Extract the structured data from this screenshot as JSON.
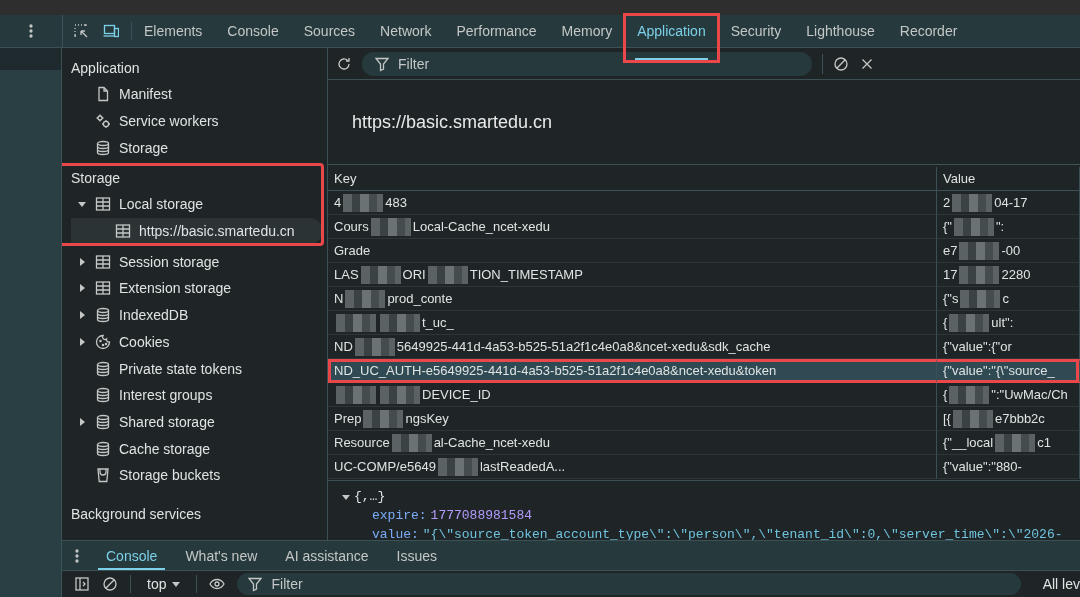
{
  "tabs": [
    {
      "label": "Elements",
      "selected": false,
      "highlighted": false
    },
    {
      "label": "Console",
      "selected": false,
      "highlighted": false
    },
    {
      "label": "Sources",
      "selected": false,
      "highlighted": false
    },
    {
      "label": "Network",
      "selected": false,
      "highlighted": false
    },
    {
      "label": "Performance",
      "selected": false,
      "highlighted": false
    },
    {
      "label": "Memory",
      "selected": false,
      "highlighted": false
    },
    {
      "label": "Application",
      "selected": true,
      "highlighted": true
    },
    {
      "label": "Security",
      "selected": false,
      "highlighted": false
    },
    {
      "label": "Lighthouse",
      "selected": false,
      "highlighted": false
    },
    {
      "label": "Recorder",
      "selected": false,
      "highlighted": false
    }
  ],
  "sidebar": {
    "sections": [
      {
        "title": "Application",
        "highlighted": false,
        "items": [
          {
            "label": "Manifest",
            "kind": "file",
            "selected": false
          },
          {
            "label": "Service workers",
            "kind": "gears",
            "selected": false
          },
          {
            "label": "Storage",
            "kind": "database",
            "selected": false
          }
        ]
      },
      {
        "title": "Storage",
        "highlighted": true,
        "items": [
          {
            "label": "Local storage",
            "kind": "table",
            "selected": false,
            "expanded": true,
            "children": [
              {
                "label": "https://basic.smartedu.cn",
                "kind": "table",
                "selected": true
              }
            ]
          }
        ]
      },
      {
        "highlighted": false,
        "items": [
          {
            "label": "Session storage",
            "kind": "table",
            "selected": false,
            "expanded": false
          },
          {
            "label": "Extension storage",
            "kind": "table",
            "selected": false,
            "expanded": false
          },
          {
            "label": "IndexedDB",
            "kind": "database",
            "selected": false,
            "expanded": false
          },
          {
            "label": "Cookies",
            "kind": "cookie",
            "selected": false,
            "expanded": false
          },
          {
            "label": "Private state tokens",
            "kind": "database",
            "selected": false
          },
          {
            "label": "Interest groups",
            "kind": "database",
            "selected": false
          },
          {
            "label": "Shared storage",
            "kind": "database",
            "selected": false,
            "expanded": false
          },
          {
            "label": "Cache storage",
            "kind": "database",
            "selected": false
          },
          {
            "label": "Storage buckets",
            "kind": "bucket",
            "selected": false
          }
        ]
      },
      {
        "title": "Background services",
        "highlighted": false
      }
    ]
  },
  "toolbar": {
    "filter_placeholder": "Filter"
  },
  "origin": "https://basic.smartedu.cn",
  "table": {
    "columns": [
      "Key",
      "Value"
    ],
    "rows": [
      {
        "key": [
          "4",
          "483"
        ],
        "value": [
          "2",
          "04-17"
        ],
        "selected": false,
        "highlighted": false
      },
      {
        "key": [
          "Cours",
          "Local-Cache_ncet-xedu"
        ],
        "value": [
          "{\"",
          "\":"
        ],
        "selected": false,
        "highlighted": false
      },
      {
        "key": [
          "Grade"
        ],
        "value": [
          "e7",
          "-00"
        ],
        "selected": false,
        "highlighted": false
      },
      {
        "key": [
          "LAS",
          "ORI",
          "TION_TIMESTAMP"
        ],
        "value": [
          "17",
          "2280"
        ],
        "selected": false,
        "highlighted": false
      },
      {
        "key": [
          "N",
          "prod_conte"
        ],
        "value": [
          "{\"s",
          "c"
        ],
        "selected": false,
        "highlighted": false
      },
      {
        "masked_start": true,
        "key": [
          "t_uc_"
        ],
        "value": [
          "{",
          "ult\":"
        ],
        "selected": false,
        "highlighted": false
      },
      {
        "key": [
          "ND",
          "5649925-441d-4a53-b525-51a2f1c4e0a8&ncet-xedu&sdk_cache"
        ],
        "value": [
          "{\"value\":{\"or"
        ],
        "selected": false,
        "highlighted": false
      },
      {
        "key": [
          "ND_UC_AUTH-e5649925-441d-4a53-b525-51a2f1c4e0a8&ncet-xedu&token"
        ],
        "value": [
          "{\"value\":\"{\\\"source_"
        ],
        "selected": true,
        "highlighted": true
      },
      {
        "masked_start": true,
        "key": [
          "DEVICE_ID"
        ],
        "value": [
          "{",
          "\":\"UwMac/Ch"
        ],
        "selected": false,
        "highlighted": false
      },
      {
        "key": [
          "Prep",
          "ngsKey"
        ],
        "value": [
          "[{",
          "e7bbb2c"
        ],
        "selected": false,
        "highlighted": false
      },
      {
        "key": [
          "Resource",
          "al-Cache_ncet-xedu"
        ],
        "value": [
          "{\"__local",
          "c1"
        ],
        "selected": false,
        "highlighted": false
      },
      {
        "key": [
          "UC-COMP/e5649",
          "lastReadedA..."
        ],
        "value": [
          "{\"value\":\"880-"
        ],
        "selected": false,
        "highlighted": false
      }
    ]
  },
  "preview": {
    "summary": "{,…}",
    "expanded": true,
    "props": [
      {
        "name": "expire:",
        "value": "1777088981584",
        "kind": "number"
      },
      {
        "name": "value:",
        "value": "\"{\\\"source_token_account_type\\\":\\\"person\\\",\\\"tenant_id\\\":0,\\\"server_time\\\":\\\"2026-",
        "kind": "string"
      }
    ]
  },
  "drawer": {
    "tabs": [
      {
        "label": "Console",
        "selected": true
      },
      {
        "label": "What's new",
        "selected": false
      },
      {
        "label": "AI assistance",
        "selected": false
      },
      {
        "label": "Issues",
        "selected": false
      }
    ],
    "context": "top",
    "filter_placeholder": "Filter",
    "levels": "All lev"
  }
}
